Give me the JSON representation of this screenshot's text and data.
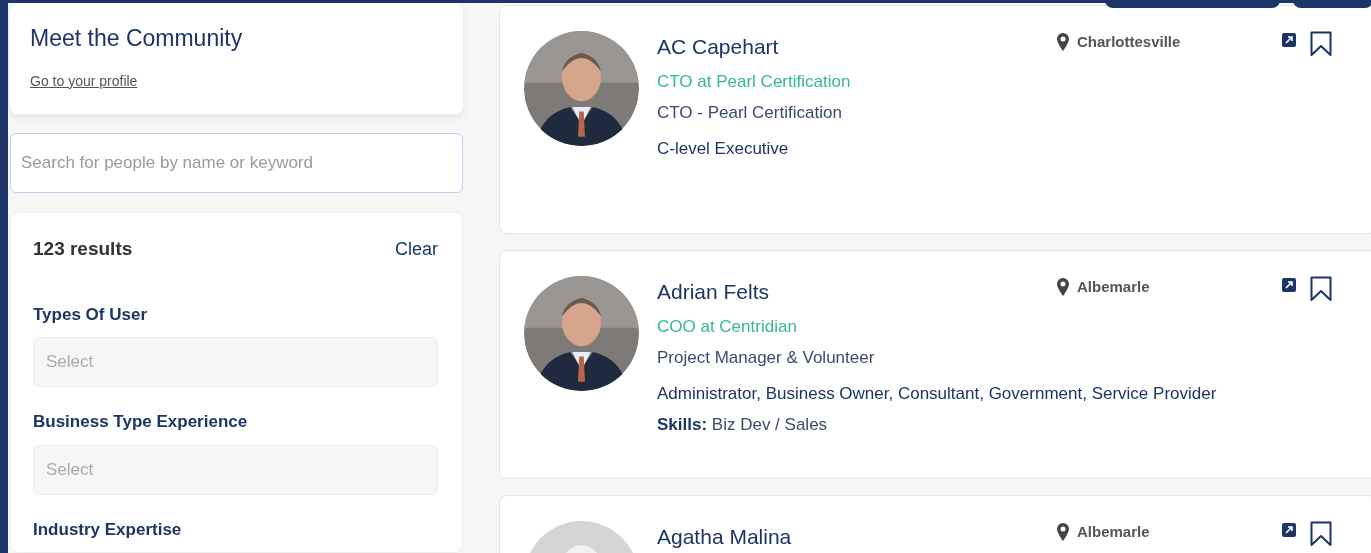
{
  "intro": {
    "title": "Meet the Community",
    "profile_link": "Go to your profile"
  },
  "search": {
    "placeholder": "Search for people by name or keyword"
  },
  "filters": {
    "results": "123 results",
    "clear": "Clear",
    "groups": [
      {
        "label": "Types Of User",
        "placeholder": "Select"
      },
      {
        "label": "Business Type Experience",
        "placeholder": "Select"
      },
      {
        "label": "Industry Expertise"
      }
    ]
  },
  "people": [
    {
      "name": "AC Capehart",
      "location": "Charlottesville",
      "headline": "CTO at Pearl Certification",
      "subtitle": "CTO - Pearl Certification",
      "roles": "C-level Executive"
    },
    {
      "name": "Adrian Felts",
      "location": "Albemarle",
      "headline": "COO at Centridian",
      "subtitle": "Project Manager & Volunteer",
      "roles": "Administrator, Business Owner, Consultant, Government, Service Provider",
      "skills": "**Skills:** Biz Dev / Sales"
    },
    {
      "name": "Agatha Malina",
      "avatar": {
        "kind": "placeholder"
      },
      "location": "Albemarle"
    }
  ]
}
